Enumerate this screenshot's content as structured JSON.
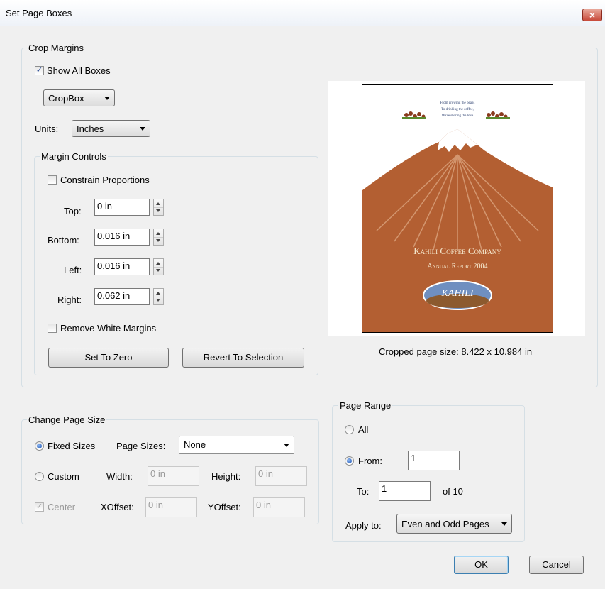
{
  "window": {
    "title": "Set Page Boxes",
    "close_label": "×"
  },
  "crop_margins": {
    "legend": "Crop Margins",
    "show_all_boxes_label": "Show All Boxes",
    "show_all_boxes_checked": true,
    "box_select": "CropBox",
    "units_label": "Units:",
    "units_value": "Inches"
  },
  "margin_controls": {
    "legend": "Margin Controls",
    "constrain_label": "Constrain Proportions",
    "top_label": "Top:",
    "top_value": "0 in",
    "bottom_label": "Bottom:",
    "bottom_value": "0.016 in",
    "left_label": "Left:",
    "left_value": "0.016 in",
    "right_label": "Right:",
    "right_value": "0.062 in",
    "remove_white_label": "Remove White Margins",
    "set_zero_label": "Set To Zero",
    "revert_label": "Revert To Selection"
  },
  "preview": {
    "tagline_1": "From growing the beans",
    "tagline_2": "To drinking the coffee,",
    "tagline_3": "We're sharing the love",
    "company": "Kahili Coffee Company",
    "report": "Annual Report 2004",
    "logo_text": "KAHILI",
    "cropped_size": "Cropped page size: 8.422 x 10.984 in"
  },
  "change_page_size": {
    "legend": "Change Page Size",
    "fixed_label": "Fixed Sizes",
    "page_sizes_label": "Page Sizes:",
    "page_sizes_value": "None",
    "custom_label": "Custom",
    "width_label": "Width:",
    "width_value": "0 in",
    "height_label": "Height:",
    "height_value": "0 in",
    "center_label": "Center",
    "xoffset_label": "XOffset:",
    "xoffset_value": "0 in",
    "yoffset_label": "YOffset:",
    "yoffset_value": "0 in"
  },
  "page_range": {
    "legend": "Page Range",
    "all_label": "All",
    "from_label": "From:",
    "from_value": "1",
    "to_label": "To:",
    "to_value": "1",
    "of_label": "of 10",
    "apply_label": "Apply to:",
    "apply_value": "Even and Odd Pages"
  },
  "footer": {
    "ok_label": "OK",
    "cancel_label": "Cancel"
  },
  "colors": {
    "mountain": "#b35f32",
    "snow": "#ffffff",
    "text_cream": "#f6ead0",
    "logo_blue": "#6f8fc0"
  }
}
